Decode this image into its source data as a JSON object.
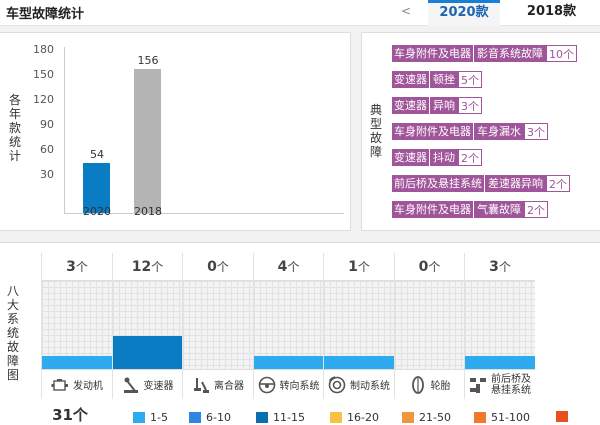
{
  "header": {
    "title": "车型故障统计",
    "prev_arrow": "<",
    "tabs": [
      {
        "label": "2020款",
        "active": true
      },
      {
        "label": "2018款",
        "active": false
      }
    ]
  },
  "yearly_chart": {
    "side_label": [
      "各",
      "年",
      "款",
      "统",
      "计"
    ],
    "yticks": [
      "180",
      "150",
      "120",
      "90",
      "60",
      "30"
    ],
    "chart_data": {
      "type": "bar",
      "categories": [
        "2020",
        "2018"
      ],
      "values": [
        54,
        156
      ],
      "value_labels": [
        "54",
        "156"
      ],
      "ylim": [
        0,
        180
      ],
      "colors": [
        "#0a7cc4",
        "#b4b4b4"
      ]
    }
  },
  "typical_faults": {
    "side_label": [
      "典",
      "型",
      "故",
      "障"
    ],
    "items": [
      {
        "category": "车身附件及电器",
        "fault": "影音系统故障",
        "count": "10个"
      },
      {
        "category": "变速器",
        "fault": "顿挫",
        "count": "5个"
      },
      {
        "category": "变速器",
        "fault": "异响",
        "count": "3个"
      },
      {
        "category": "车身附件及电器",
        "fault": "车身漏水",
        "count": "3个"
      },
      {
        "category": "变速器",
        "fault": "抖动",
        "count": "2个"
      },
      {
        "category": "前后桥及悬挂系统",
        "fault": "差速器异响",
        "count": "2个"
      },
      {
        "category": "车身附件及电器",
        "fault": "气囊故障",
        "count": "2个"
      }
    ]
  },
  "eight_systems": {
    "side_label": [
      "八",
      "大",
      "系",
      "统",
      "故",
      "障",
      "图"
    ],
    "unit": "个",
    "systems": [
      {
        "name": "发动机",
        "count": "3",
        "level": 0.15,
        "color": "#2eaaf0",
        "icon": "engine-icon"
      },
      {
        "name": "变速器",
        "count": "12",
        "level": 0.37,
        "color": "#0a7cc4",
        "icon": "gear-shift-icon"
      },
      {
        "name": "离合器",
        "count": "0",
        "level": 0,
        "color": "#2eaaf0",
        "icon": "clutch-icon"
      },
      {
        "name": "转向系统",
        "count": "4",
        "level": 0.15,
        "color": "#2eaaf0",
        "icon": "steering-wheel-icon"
      },
      {
        "name": "制动系统",
        "count": "1",
        "level": 0.15,
        "color": "#2eaaf0",
        "icon": "brake-disc-icon"
      },
      {
        "name": "轮胎",
        "count": "0",
        "level": 0,
        "color": "#2eaaf0",
        "icon": "tire-icon"
      },
      {
        "name": "前后桥及悬挂系统",
        "name_lines": [
          "前后桥及",
          "悬挂系统"
        ],
        "count": "3",
        "level": 0.15,
        "color": "#2eaaf0",
        "icon": "suspension-icon"
      }
    ],
    "total": "31个"
  },
  "legend": [
    {
      "label": "1-5",
      "color": "#2eaaf0"
    },
    {
      "label": "6-10",
      "color": "#2e86e0"
    },
    {
      "label": "11-15",
      "color": "#0a6fb0"
    },
    {
      "label": "16-20",
      "color": "#f5c242"
    },
    {
      "label": "21-50",
      "color": "#f0963c"
    },
    {
      "label": "51-100",
      "color": "#ef7a2c"
    },
    {
      "label": "",
      "color": "#e8501e"
    }
  ]
}
